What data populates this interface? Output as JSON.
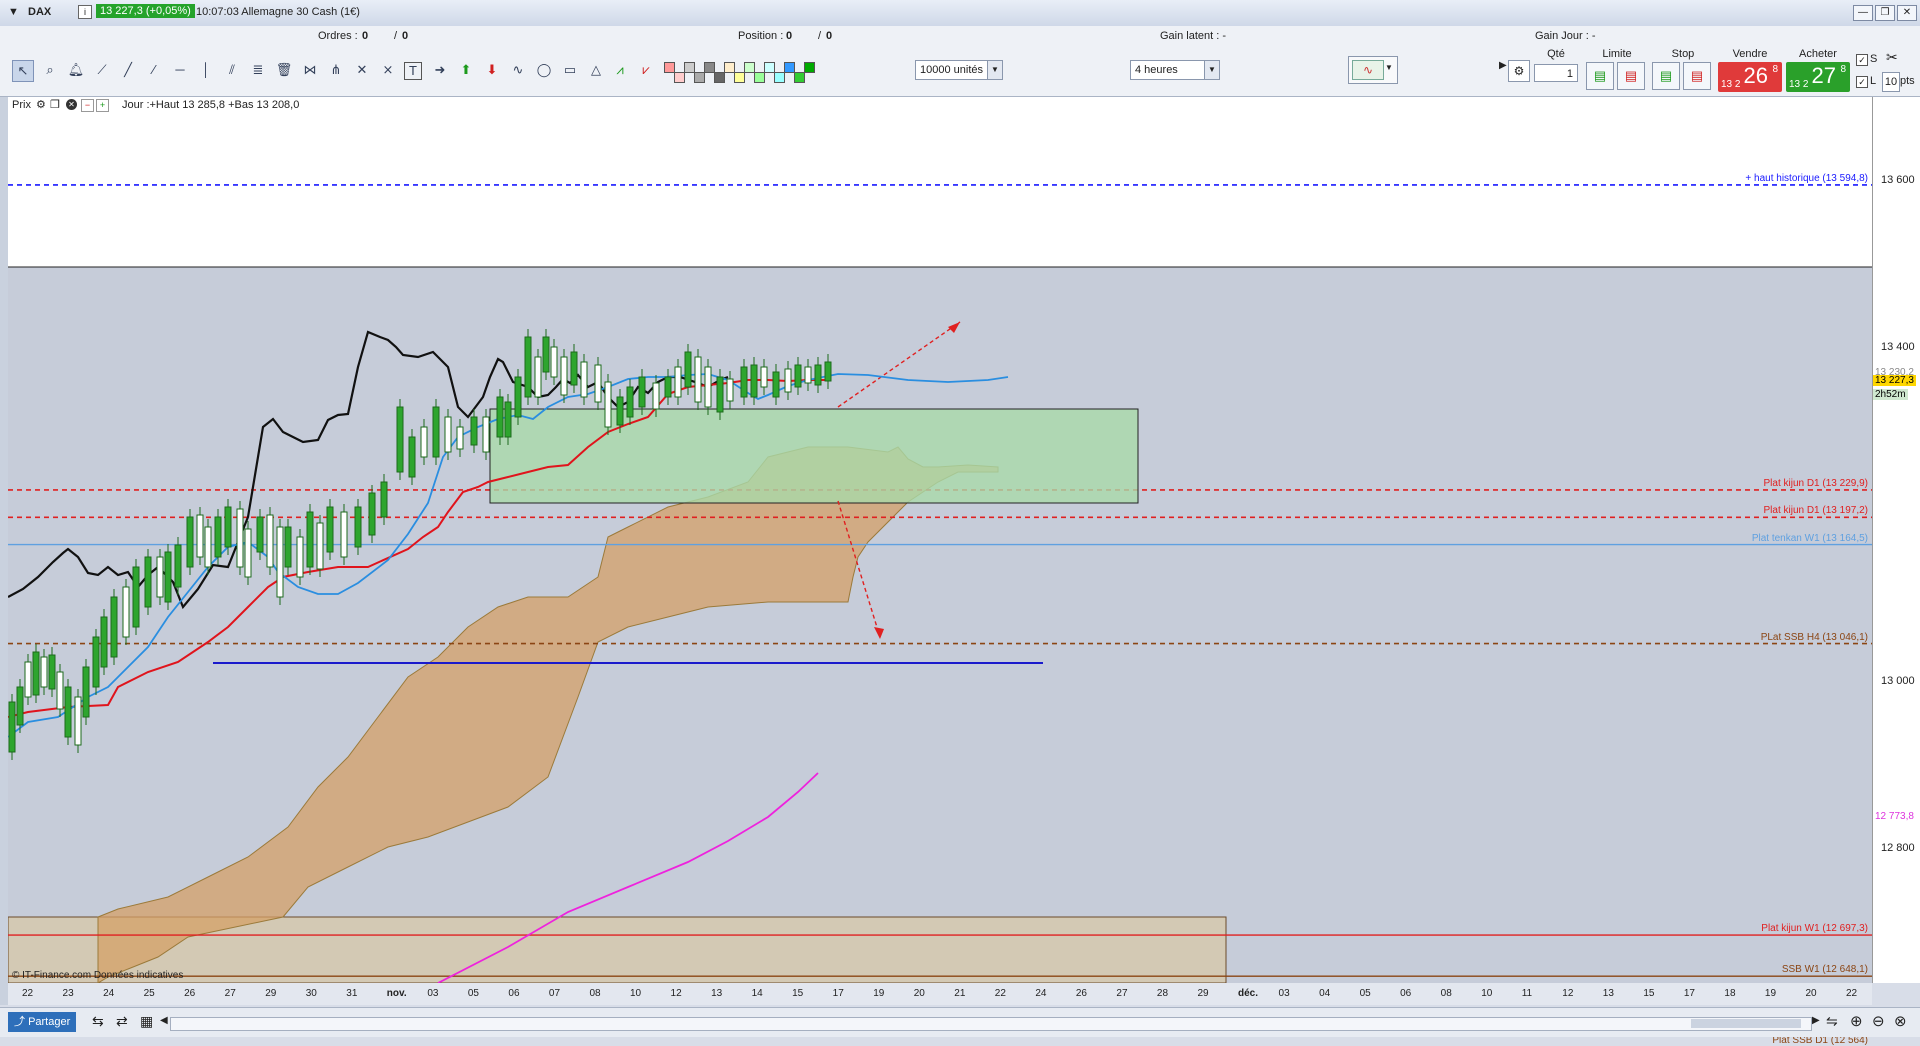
{
  "window": {
    "symbol": "DAX",
    "price_badge": "13 227,3 (+0,05%)",
    "description": "10:07:03  Allemagne 30 Cash (1€)"
  },
  "toolbar": {
    "orders_label": "Ordres :",
    "orders_value": "0",
    "orders_sep": "/",
    "orders_value2": "0",
    "position_label": "Position :",
    "position_value": "0",
    "position_sep": "/",
    "position_value2": "0",
    "gain_latent": "Gain latent : -",
    "gain_jour": "Gain Jour : -",
    "units_select": "10000 unités",
    "period_select": "4 heures",
    "colors": [
      "#ff9999",
      "#ffcccc",
      "#cccccc",
      "#aaaaaa",
      "#888888",
      "#666666",
      "#ffeecc",
      "#ffff99",
      "#ccffcc",
      "#99ff99",
      "#ccffff",
      "#99ffff",
      "#3399ff",
      "#33cc33",
      "#00aa00"
    ]
  },
  "order_panel": {
    "qty_header": "Qté",
    "qty_value": "1",
    "limit_header": "Limite",
    "stop_header": "Stop",
    "sell_header": "Vendre",
    "buy_header": "Acheter",
    "sell_small": "13 2",
    "sell_big": "26",
    "sell_sup": "8",
    "buy_small": "13 2",
    "buy_big": "27",
    "buy_sup": "8",
    "s_label": "S",
    "l_label": "L",
    "pts_value": "10",
    "pts_label": "pts"
  },
  "chart_header": {
    "prix_label": "Prix",
    "info": "Jour :+Haut 13 285,8 +Bas 13 208,0"
  },
  "chart": {
    "ylim": [
      12640,
      13700
    ],
    "y_ticks": [
      {
        "v": 13600,
        "t": "13 600"
      },
      {
        "v": 13400,
        "t": "13 400"
      },
      {
        "v": 13000,
        "t": "13 000"
      },
      {
        "v": 12800,
        "t": "12 800"
      }
    ],
    "x_ticks": [
      "22",
      "23",
      "24",
      "25",
      "26",
      "27",
      "29",
      "30",
      "31",
      "nov.",
      "03",
      "05",
      "06",
      "07",
      "08",
      "10",
      "12",
      "13",
      "14",
      "15",
      "17",
      "19",
      "20",
      "21",
      "22",
      "24",
      "26",
      "27",
      "28",
      "29",
      "déc.",
      "03",
      "04",
      "05",
      "06",
      "08",
      "10",
      "11",
      "12",
      "13",
      "15",
      "17",
      "18",
      "19",
      "20",
      "22"
    ],
    "price_flags": [
      {
        "text": "13 230,2",
        "color": "#888888",
        "bg": "#ffffff"
      },
      {
        "text": "13 227,3",
        "color": "#000000",
        "bg": "#ffd700"
      },
      {
        "text": "2h52m",
        "color": "#000000",
        "bg": "#cfe8cf"
      },
      {
        "text": "12 773,8",
        "color": "#dd33dd",
        "bg": "#ffffff"
      }
    ],
    "levels": [
      {
        "label": "+ haut historique (13 594,8)",
        "value": 13594.8,
        "color": "#1a1aff",
        "style": "dash"
      },
      {
        "label": "Plat kijun D1 (13 229,9)",
        "value": 13229.9,
        "color": "#e02020",
        "style": "dash"
      },
      {
        "label": "Plat kijun D1 (13 197,2)",
        "value": 13197.2,
        "color": "#e02020",
        "style": "dash"
      },
      {
        "label": "Plat tenkan W1 (13 164,5)",
        "value": 13164.5,
        "color": "#5fa0e0",
        "style": "solid"
      },
      {
        "label": "PLat SSB H4 (13 046,1)",
        "value": 13046.1,
        "color": "#8b4513",
        "style": "dash"
      },
      {
        "label": "Plat kijun W1 (12 697,3)",
        "value": 12697.3,
        "color": "#e02020",
        "style": "solid"
      },
      {
        "label": "SSB W1 (12 648,1)",
        "value": 12648.1,
        "color": "#8b4513",
        "style": "solid"
      },
      {
        "label": "Plat SSB D1 (12 564)",
        "value": 12564,
        "color": "#8b4513",
        "style": "none"
      }
    ],
    "footer_note": "© IT-Finance.com  Données indicatives"
  },
  "bottom": {
    "share_label": "Partager"
  }
}
